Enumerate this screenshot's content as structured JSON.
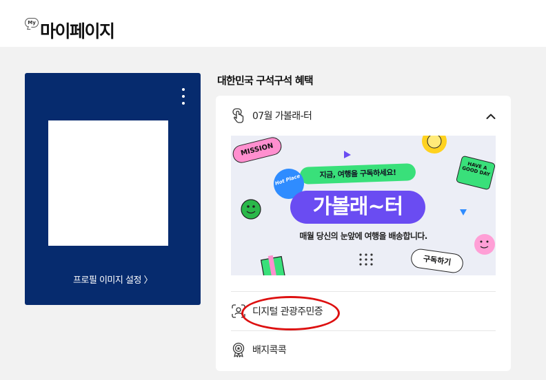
{
  "header": {
    "badge": "My",
    "title": "마이페이지"
  },
  "profile": {
    "settings_link": "프로필 이미지 설정 〉"
  },
  "benefits": {
    "section_title": "대한민국 구석구석 혜택",
    "subscription": {
      "label": "07월 가볼래-터",
      "icon": "touch-hand-icon"
    },
    "banner": {
      "mission": "MISSION",
      "hot_place": "Hot Place",
      "tag": "지금, 여행을 구독하세요!",
      "headline": "가볼래~터",
      "description": "매월 당신의 눈앞에 여행을 배송합니다.",
      "good_day": "HAVE A GOOD DAY",
      "subscribe": "구독하기",
      "colors": {
        "background": "#eceef6",
        "purple": "#6a4cf2",
        "green": "#39e07a",
        "pink": "#ff8fcf",
        "yellow": "#ffd21f"
      }
    },
    "digital_id": {
      "label": "디지털 관광주민증",
      "icon": "face-scan-icon"
    },
    "badges": {
      "label": "배지콕콕",
      "icon": "medal-icon"
    }
  },
  "colors": {
    "profile_card": "#062b6e",
    "annotation": "#dd1010"
  }
}
